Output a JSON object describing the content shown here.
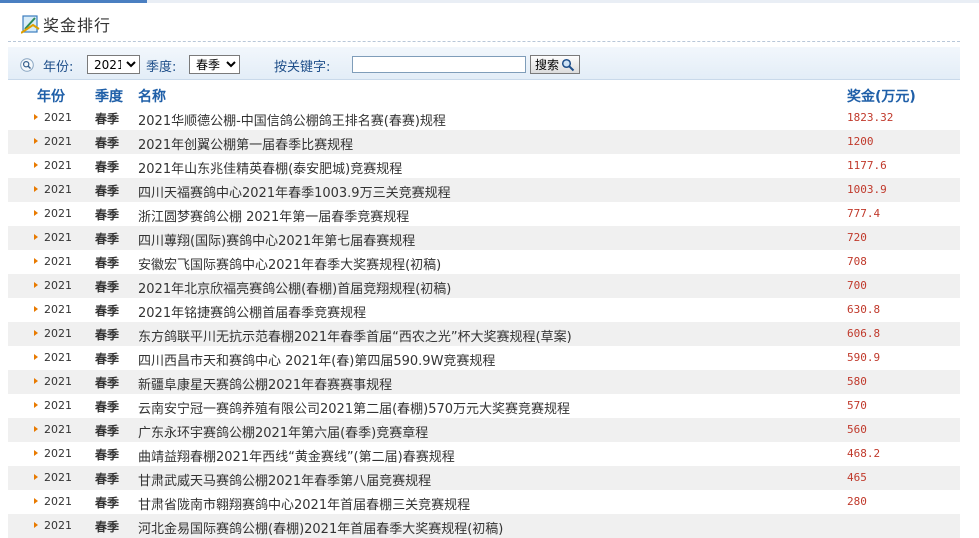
{
  "page": {
    "title": "奖金排行"
  },
  "search": {
    "year_label": "年份:",
    "year_value": "2021",
    "season_label": "季度:",
    "season_value": "春季",
    "keyword_label": "按关键字:",
    "keyword_value": "",
    "button_label": "搜索"
  },
  "table": {
    "headers": {
      "year": "年份",
      "season": "季度",
      "name": "名称",
      "prize": "奖金(万元)"
    },
    "rows": [
      {
        "year": "2021",
        "season": "春季",
        "name": "2021华顺德公棚-中国信鸽公棚鸽王排名赛(春赛)规程",
        "prize": "1823.32"
      },
      {
        "year": "2021",
        "season": "春季",
        "name": "2021年创翼公棚第一届春季比赛规程",
        "prize": "1200"
      },
      {
        "year": "2021",
        "season": "春季",
        "name": "2021年山东兆佳精英春棚(泰安肥城)竞赛规程",
        "prize": "1177.6"
      },
      {
        "year": "2021",
        "season": "春季",
        "name": "四川天福赛鸽中心2021年春季1003.9万三关竞赛规程",
        "prize": "1003.9"
      },
      {
        "year": "2021",
        "season": "春季",
        "name": "浙江圆梦赛鸽公棚 2021年第一届春季竞赛规程",
        "prize": "777.4"
      },
      {
        "year": "2021",
        "season": "春季",
        "name": "四川蓴翔(国际)赛鸽中心2021年第七届春赛规程",
        "prize": "720"
      },
      {
        "year": "2021",
        "season": "春季",
        "name": "安徽宏飞国际赛鸽中心2021年春季大奖赛规程(初稿)",
        "prize": "708"
      },
      {
        "year": "2021",
        "season": "春季",
        "name": "2021年北京欣福亮赛鸽公棚(春棚)首届竞翔规程(初稿)",
        "prize": "700"
      },
      {
        "year": "2021",
        "season": "春季",
        "name": "2021年铭捷赛鸽公棚首届春季竞赛规程",
        "prize": "630.8"
      },
      {
        "year": "2021",
        "season": "春季",
        "name": "东方鸽联平川无抗示范春棚2021年春季首届“西农之光”杯大奖赛规程(草案)",
        "prize": "606.8"
      },
      {
        "year": "2021",
        "season": "春季",
        "name": "四川西昌市天和赛鸽中心 2021年(春)第四届590.9W竞赛规程",
        "prize": "590.9"
      },
      {
        "year": "2021",
        "season": "春季",
        "name": "新疆阜康星天赛鸽公棚2021年春赛赛事规程",
        "prize": "580"
      },
      {
        "year": "2021",
        "season": "春季",
        "name": "云南安宁冠一赛鸽养殖有限公司2021第二届(春棚)570万元大奖赛竞赛规程",
        "prize": "570"
      },
      {
        "year": "2021",
        "season": "春季",
        "name": "广东永环宇赛鸽公棚2021年第六届(春季)竞赛章程",
        "prize": "560"
      },
      {
        "year": "2021",
        "season": "春季",
        "name": "曲靖益翔春棚2021年西线“黄金赛线”(第二届)春赛规程",
        "prize": "468.2"
      },
      {
        "year": "2021",
        "season": "春季",
        "name": "甘肃武威天马赛鸽公棚2021年春季第八届竞赛规程",
        "prize": "465"
      },
      {
        "year": "2021",
        "season": "春季",
        "name": "甘肃省陇南市翱翔赛鸽中心2021年首届春棚三关竞赛规程",
        "prize": "280"
      },
      {
        "year": "2021",
        "season": "春季",
        "name": "河北金易国际赛鸽公棚(春棚)2021年首届春季大奖赛规程(初稿)",
        "prize": ""
      }
    ]
  }
}
